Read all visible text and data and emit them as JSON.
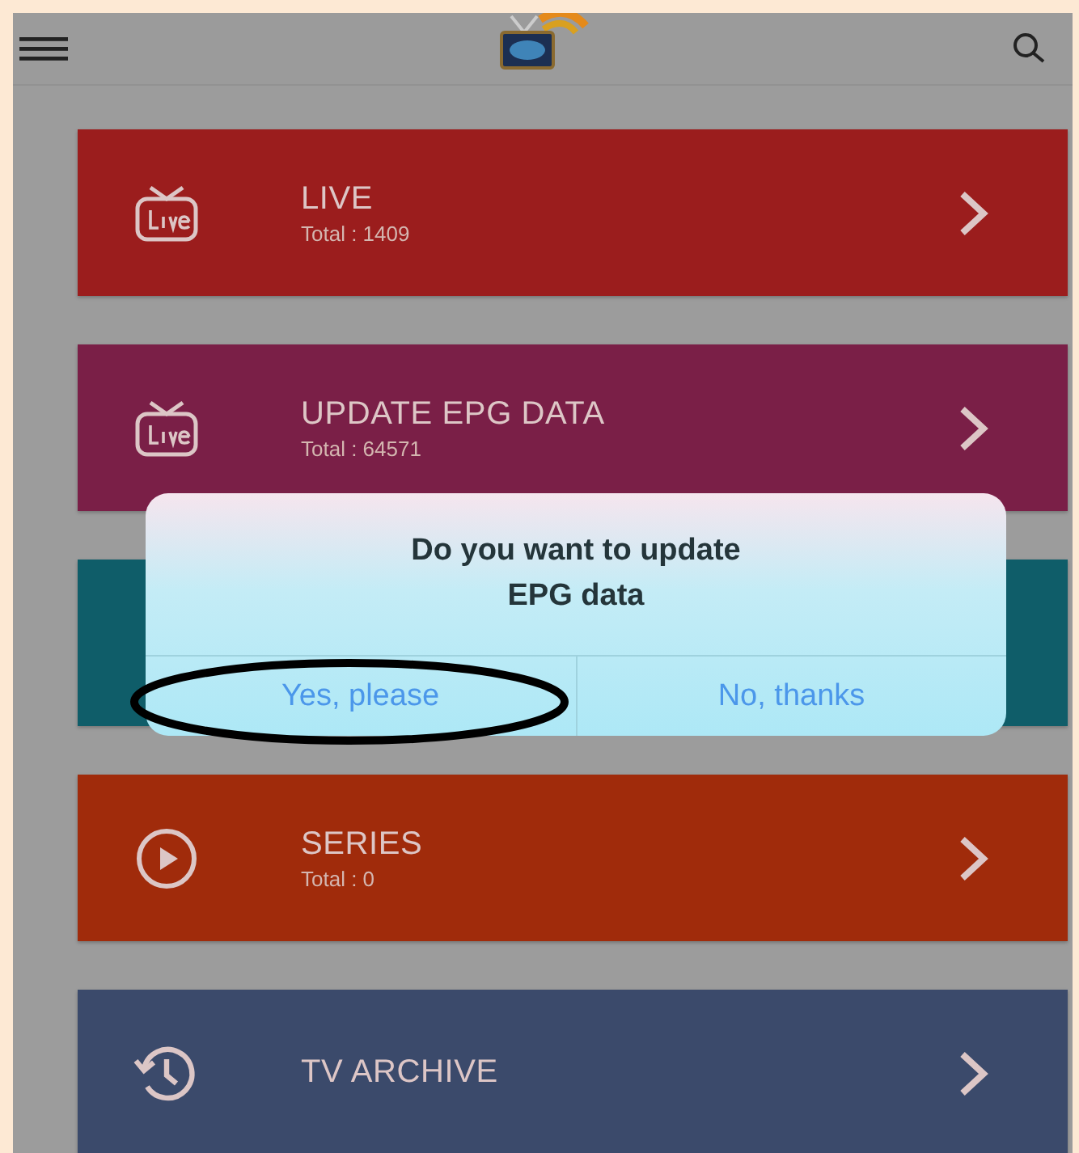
{
  "cards": [
    {
      "kind": "live",
      "title": "LIVE",
      "subtitle": "Total : 1409",
      "color": "#9b1d1d"
    },
    {
      "kind": "live",
      "title": "UPDATE EPG DATA",
      "subtitle": "Total : 64571",
      "color": "#7a1f47"
    },
    {
      "kind": "hidden",
      "color": "#0f5d69"
    },
    {
      "kind": "play",
      "title": "SERIES",
      "subtitle": "Total : 0",
      "color": "#a02b0b"
    },
    {
      "kind": "history",
      "title": "TV ARCHIVE",
      "color": "#3b4a6b"
    }
  ],
  "dialog": {
    "message": "Do you want to update EPG data",
    "buttons": [
      {
        "label": "Yes, please",
        "circled": true
      },
      {
        "label": "No, thanks",
        "circled": false
      }
    ]
  }
}
